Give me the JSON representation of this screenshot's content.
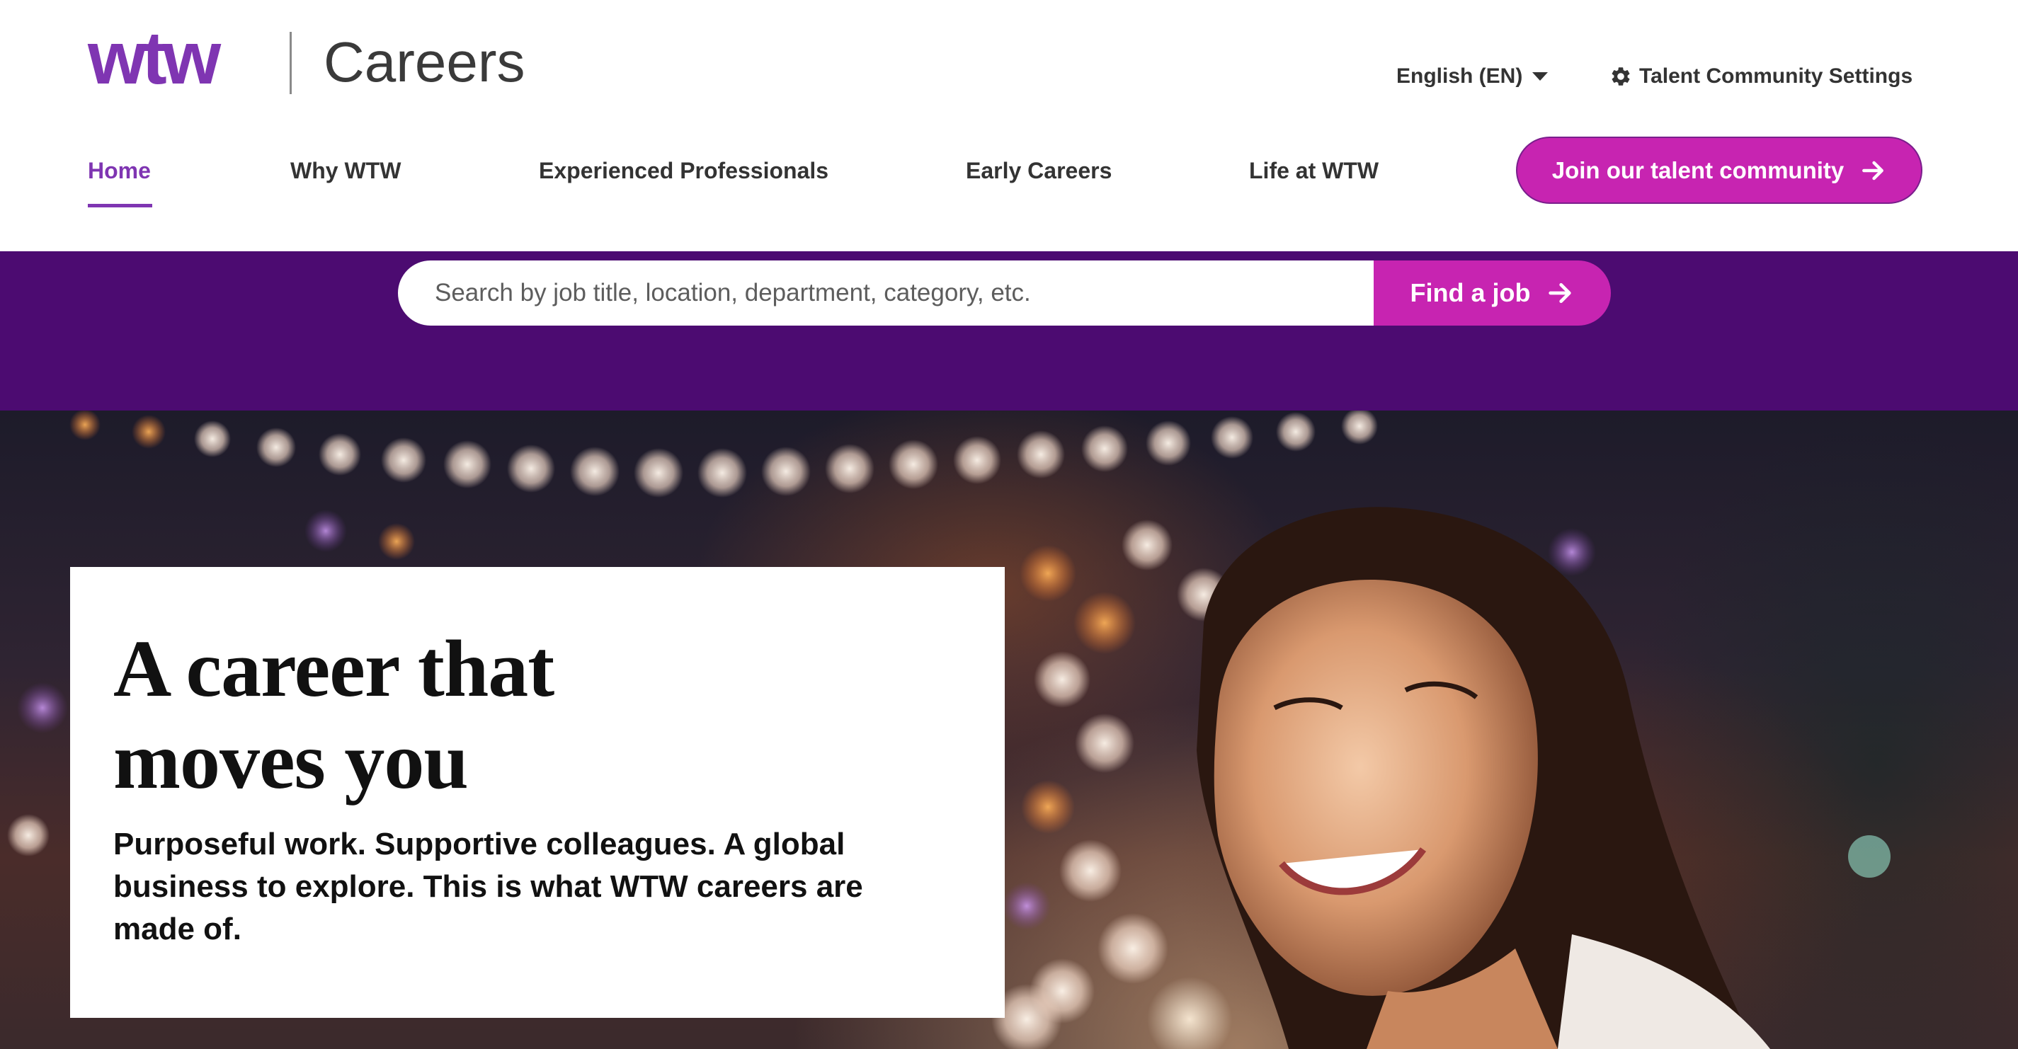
{
  "brand": {
    "logo_text": "wtw",
    "site_title": "Careers"
  },
  "header": {
    "language": "English (EN)",
    "settings_label": "Talent Community Settings"
  },
  "nav": {
    "items": [
      {
        "label": "Home",
        "active": true
      },
      {
        "label": "Why WTW",
        "active": false
      },
      {
        "label": "Experienced Professionals",
        "active": false
      },
      {
        "label": "Early Careers",
        "active": false
      },
      {
        "label": "Life at WTW",
        "active": false
      }
    ],
    "cta_label": "Join our talent community"
  },
  "search": {
    "placeholder": "Search by job title, location, department, category, etc.",
    "button_label": "Find a job"
  },
  "hero": {
    "title_line1": "A career that",
    "title_line2": "moves you",
    "subtitle": "Purposeful work. Supportive colleagues. A global business to explore. This is what WTW careers are made of."
  },
  "colors": {
    "brand_purple": "#7f35b2",
    "band_purple": "#4c0b71",
    "accent_magenta": "#c724b1"
  },
  "icons": [
    "caret-down-icon",
    "gear-icon",
    "arrow-right-icon"
  ]
}
